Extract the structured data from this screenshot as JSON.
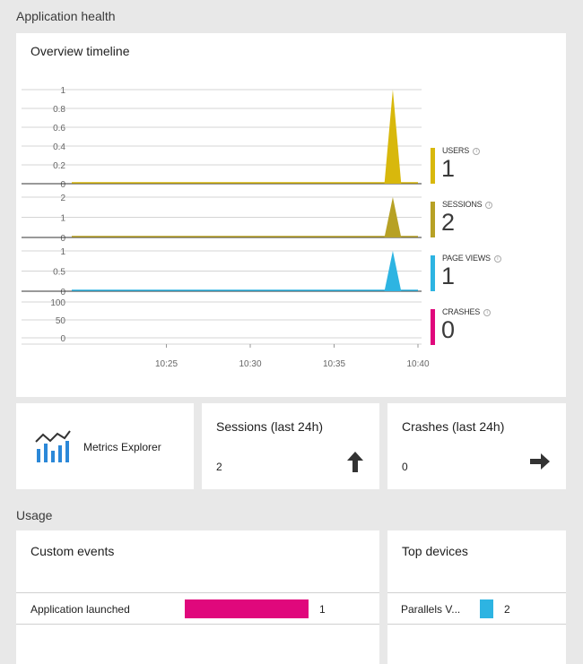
{
  "colors": {
    "users": "#d8b80c",
    "sessions": "#b7a125",
    "page_views": "#2db4e2",
    "crashes": "#e0087c",
    "grid": "#d4d4d4",
    "axis": "#333333",
    "tick_text": "#666666"
  },
  "sections": {
    "app_health": "Application health",
    "usage": "Usage"
  },
  "timeline": {
    "title": "Overview timeline",
    "x_ticks": [
      "10:25",
      "10:30",
      "10:35",
      "10:40"
    ],
    "metrics": [
      {
        "key": "users",
        "label": "USERS",
        "value": "1",
        "color_key": "users"
      },
      {
        "key": "sessions",
        "label": "SESSIONS",
        "value": "2",
        "color_key": "sessions"
      },
      {
        "key": "page_views",
        "label": "PAGE VIEWS",
        "value": "1",
        "color_key": "page_views"
      },
      {
        "key": "crashes",
        "label": "CRASHES",
        "value": "0",
        "color_key": "crashes"
      }
    ]
  },
  "chart_data": [
    {
      "type": "area",
      "title": "USERS",
      "y_ticks": [
        "1",
        "0.8",
        "0.6",
        "0.4",
        "0.2",
        "0"
      ],
      "ylim": [
        0,
        1
      ],
      "x": [
        "10:38",
        "10:38:30",
        "10:39"
      ],
      "values": [
        0,
        1,
        0
      ],
      "color": "#d8b80c"
    },
    {
      "type": "area",
      "title": "SESSIONS",
      "y_ticks": [
        "2",
        "1",
        "0"
      ],
      "ylim": [
        0,
        2
      ],
      "x": [
        "10:38",
        "10:38:30",
        "10:39"
      ],
      "values": [
        0,
        2,
        0
      ],
      "color": "#b7a125"
    },
    {
      "type": "area",
      "title": "PAGE VIEWS",
      "y_ticks": [
        "1",
        "0.5",
        "0"
      ],
      "ylim": [
        0,
        1
      ],
      "x": [
        "10:38",
        "10:38:30",
        "10:39"
      ],
      "values": [
        0,
        1,
        0
      ],
      "color": "#2db4e2"
    },
    {
      "type": "area",
      "title": "CRASHES",
      "y_ticks": [
        "100",
        "50",
        "0"
      ],
      "ylim": [
        0,
        100
      ],
      "x": [],
      "values": [],
      "color": "#e0087c"
    }
  ],
  "metrics_explorer": {
    "label": "Metrics Explorer",
    "icon": "bar-chart-trend-icon"
  },
  "sessions_kpi": {
    "title": "Sessions (last 24h)",
    "value": "2",
    "icon": "arrow-up-icon"
  },
  "crashes_kpi": {
    "title": "Crashes (last 24h)",
    "value": "0",
    "icon": "arrow-right-icon"
  },
  "custom_events": {
    "title": "Custom events",
    "rows": [
      {
        "label": "Application launched",
        "count": "1",
        "fraction": 1.0
      }
    ]
  },
  "top_devices": {
    "title": "Top devices",
    "rows": [
      {
        "label": "Parallels V...",
        "count": "2",
        "fraction": 1.0
      }
    ]
  }
}
